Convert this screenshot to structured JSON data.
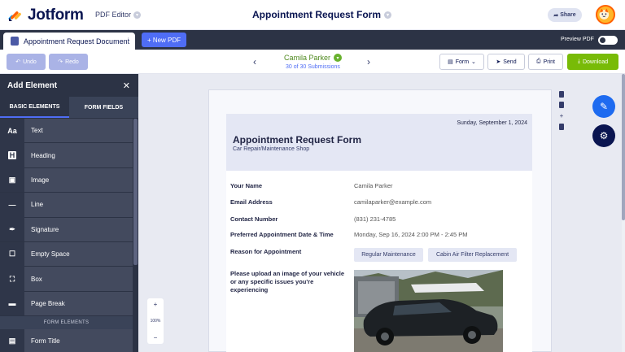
{
  "header": {
    "logo_text": "Jotform",
    "editor_label": "PDF Editor",
    "form_title": "Appointment Request Form",
    "share_label": "Share"
  },
  "tabs": {
    "document_tab": "Appointment Request Document",
    "new_pdf": "+ New PDF",
    "preview_label": "Preview PDF"
  },
  "toolbar": {
    "undo": "Undo",
    "redo": "Redo",
    "submitter_name": "Camila Parker",
    "submission_count": "30 of 30 Submissions",
    "form_dropdown": "Form",
    "send": "Send",
    "print": "Print",
    "download": "Download"
  },
  "sidebar": {
    "title": "Add Element",
    "tabs": [
      "BASIC ELEMENTS",
      "FORM FIELDS"
    ],
    "items": [
      {
        "icon": "text-icon",
        "label": "Text"
      },
      {
        "icon": "heading-icon",
        "label": "Heading"
      },
      {
        "icon": "image-icon",
        "label": "Image"
      },
      {
        "icon": "line-icon",
        "label": "Line"
      },
      {
        "icon": "signature-icon",
        "label": "Signature"
      },
      {
        "icon": "empty-space-icon",
        "label": "Empty Space"
      },
      {
        "icon": "box-icon",
        "label": "Box"
      },
      {
        "icon": "page-break-icon",
        "label": "Page Break"
      }
    ],
    "section_label": "FORM ELEMENTS",
    "form_items": [
      {
        "icon": "form-title-icon",
        "label": "Form Title"
      }
    ]
  },
  "zoom": {
    "plus": "+",
    "level": "100%",
    "minus": "−"
  },
  "document": {
    "date": "Sunday, September 1, 2024",
    "title": "Appointment Request Form",
    "subtitle": "Car Repair/Maintenance Shop",
    "fields": [
      {
        "label": "Your Name",
        "value": "Camila Parker"
      },
      {
        "label": "Email Address",
        "value": "camilaparker@example.com"
      },
      {
        "label": "Contact Number",
        "value": "(831) 231-4785"
      },
      {
        "label": "Preferred Appointment Date & Time",
        "value": "Monday, Sep 16, 2024 2:00 PM - 2:45 PM"
      },
      {
        "label": "Reason for Appointment",
        "value": ""
      }
    ],
    "reasons": [
      "Regular Maintenance",
      "Cabin Air Filter Replacement"
    ],
    "upload_label": "Please upload an image of your vehicle or any specific issues you're experiencing"
  },
  "colors": {
    "accent": "#4f6df5",
    "download": "#78bb07",
    "sidebar": "#2c3345",
    "navy": "#0a1551"
  }
}
